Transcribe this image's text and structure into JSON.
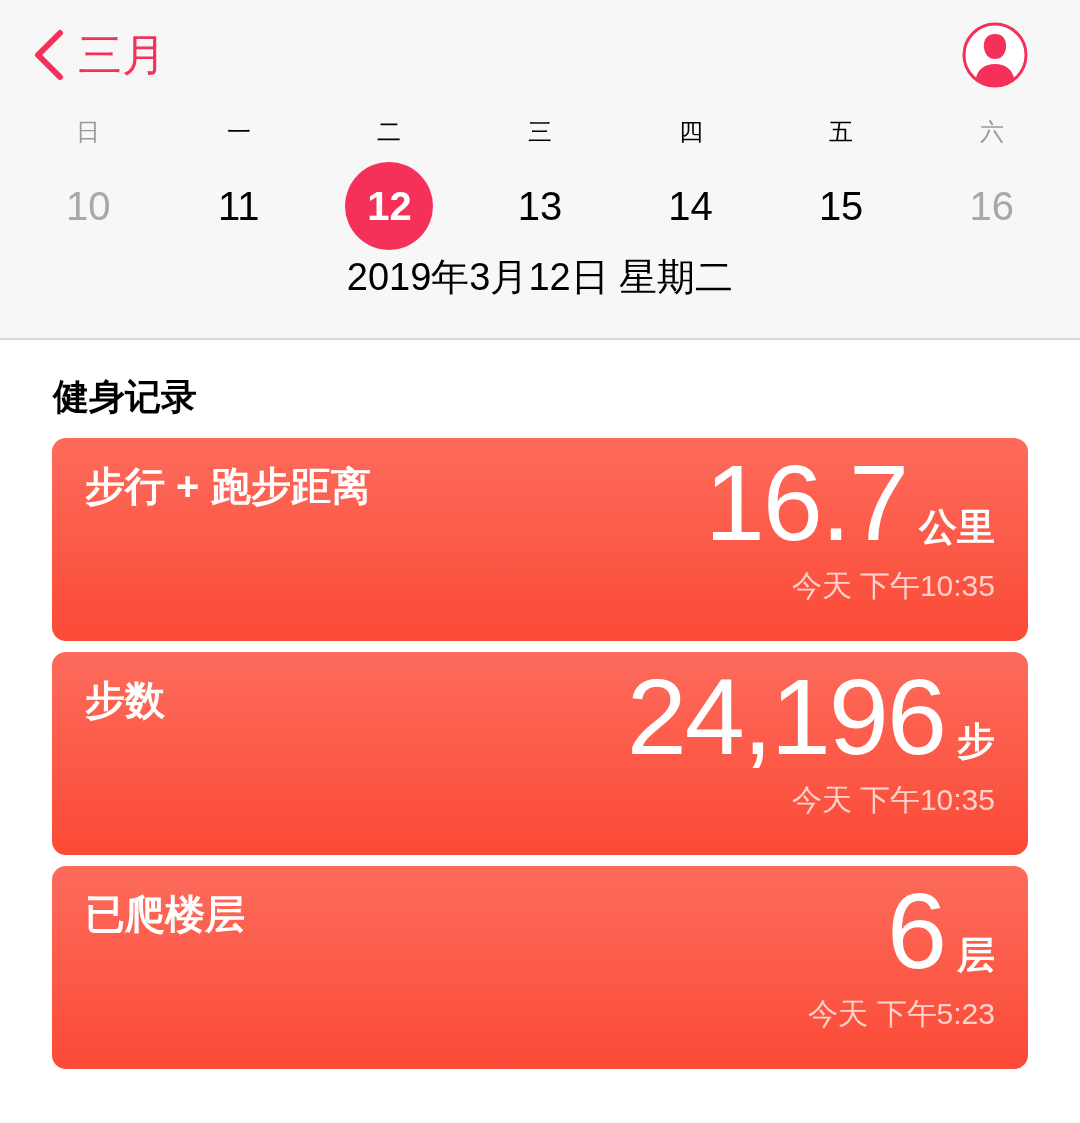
{
  "nav": {
    "back_label": "三月"
  },
  "weekdays": [
    {
      "label": "日",
      "muted": true
    },
    {
      "label": "一",
      "muted": false
    },
    {
      "label": "二",
      "muted": false
    },
    {
      "label": "三",
      "muted": false
    },
    {
      "label": "四",
      "muted": false
    },
    {
      "label": "五",
      "muted": false
    },
    {
      "label": "六",
      "muted": true
    }
  ],
  "days": [
    {
      "label": "10",
      "muted": true,
      "selected": false
    },
    {
      "label": "11",
      "muted": false,
      "selected": false
    },
    {
      "label": "12",
      "muted": false,
      "selected": true
    },
    {
      "label": "13",
      "muted": false,
      "selected": false
    },
    {
      "label": "14",
      "muted": false,
      "selected": false
    },
    {
      "label": "15",
      "muted": false,
      "selected": false
    },
    {
      "label": "16",
      "muted": true,
      "selected": false
    }
  ],
  "date_label": "2019年3月12日 星期二",
  "section_title": "健身记录",
  "cards": [
    {
      "title": "步行 + 跑步距离",
      "value": "16.7",
      "unit": "公里",
      "time": "今天 下午10:35"
    },
    {
      "title": "步数",
      "value": "24,196",
      "unit": "步",
      "time": "今天 下午10:35"
    },
    {
      "title": "已爬楼层",
      "value": "6",
      "unit": "层",
      "time": "今天 下午5:23"
    }
  ]
}
